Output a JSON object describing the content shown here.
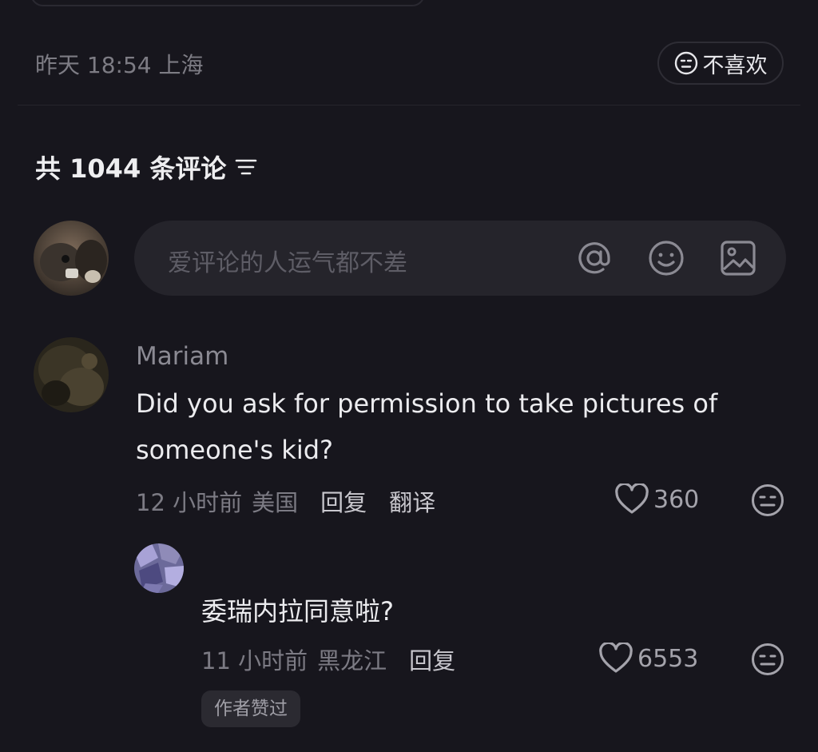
{
  "post_meta": {
    "date": "昨天 18:54",
    "location": "上海",
    "dislike_label": "不喜欢"
  },
  "comments_header": {
    "title": "共 1044 条评论",
    "sort_icon": "filter-lines-icon"
  },
  "composer": {
    "placeholder": "爱评论的人运气都不差",
    "icons": [
      "at-icon",
      "emoji-icon",
      "image-icon"
    ]
  },
  "comments": [
    {
      "username": "Mariam",
      "text_line1": "Did you ask for permission to take pictures of",
      "text_line2": "someone's kid?",
      "time": "12 小时前",
      "location": "美国",
      "reply_label": "回复",
      "translate_label": "翻译",
      "likes": "360",
      "replies": [
        {
          "text": "委瑞内拉同意啦?",
          "time": "11 小时前",
          "location": "黑龙江",
          "reply_label": "回复",
          "likes": "6553",
          "tag": "作者赞过"
        }
      ]
    }
  ],
  "colors": {
    "background": "#17161d",
    "input_background": "#25242b",
    "muted_text": "#7d7c84"
  }
}
